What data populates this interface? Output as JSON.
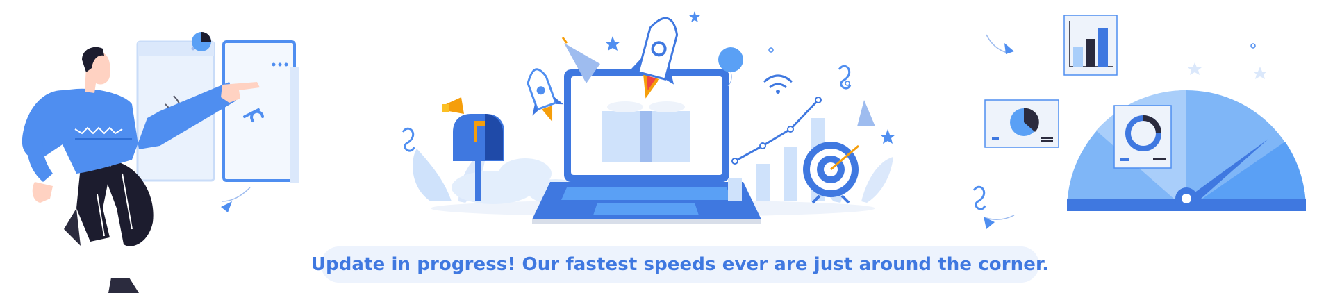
{
  "banner": {
    "message": "Update in progress! Our fastest speeds ever are just around the corner."
  },
  "colors": {
    "primary": "#3f78e0",
    "primary_light": "#5aa0f5",
    "banner_bg": "#edf3fd",
    "dark": "#1c1c2e",
    "accent_orange": "#f59e0b",
    "accent_red": "#ef4444"
  },
  "icons": {
    "person": "person-pointing-icon",
    "browser_windows": "browser-windows-icon",
    "laptop": "laptop-icon",
    "rocket": "rocket-icon",
    "mailbox": "mailbox-icon",
    "target": "target-icon",
    "speedometer": "speedometer-icon",
    "charts": "mini-chart-icon"
  }
}
